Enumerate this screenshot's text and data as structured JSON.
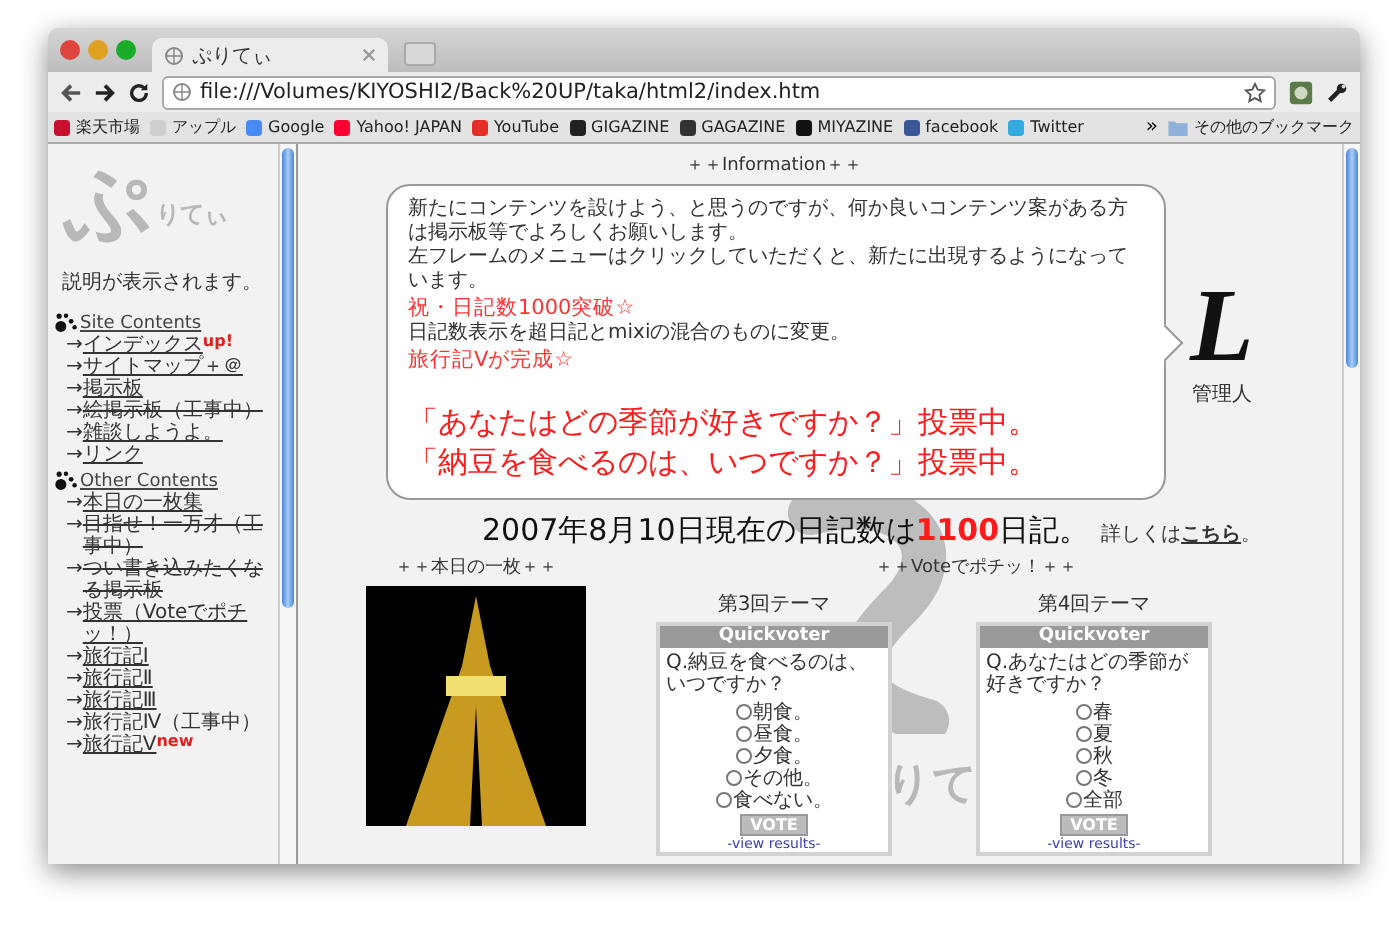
{
  "browser": {
    "tab": {
      "title": "ぷりてぃ",
      "selected": true
    },
    "url": "file:///Volumes/KIYOSHI2/Back%20UP/taka/html2/index.htm",
    "bookmarks": [
      {
        "label": "楽天市場",
        "color": "#c8102e"
      },
      {
        "label": "アップル",
        "color": "#cfcfcf"
      },
      {
        "label": "Google",
        "color": "#4a8af4"
      },
      {
        "label": "Yahoo! JAPAN",
        "color": "#ff0033"
      },
      {
        "label": "YouTube",
        "color": "#e52d27"
      },
      {
        "label": "GIGAZINE",
        "color": "#222222"
      },
      {
        "label": "GAGAZINE",
        "color": "#333333"
      },
      {
        "label": "MIYAZINE",
        "color": "#111111"
      },
      {
        "label": "facebook",
        "color": "#3b5998"
      },
      {
        "label": "Twitter",
        "color": "#33aadd"
      }
    ],
    "overflow": "»",
    "other_bookmarks": "その他のブックマーク"
  },
  "sidebar": {
    "logo_big": "ぷ",
    "logo_small": "りてぃ",
    "description": "説明が表示されます。",
    "sections": [
      {
        "title": "Site Contents",
        "items": [
          {
            "marker": "→",
            "label": "インデックス",
            "kind": "link",
            "badge": "up!"
          },
          {
            "marker": "→",
            "label": "サイトマップ＋＠",
            "kind": "link"
          },
          {
            "marker": "→",
            "label": "掲示板",
            "kind": "link"
          },
          {
            "marker": "→",
            "label": "絵掲示板（工事中）",
            "kind": "struck"
          },
          {
            "marker": "→",
            "label": "雑談しようよ。",
            "kind": "link"
          },
          {
            "marker": "→",
            "label": "リンク",
            "kind": "link"
          }
        ]
      },
      {
        "title": "Other Contents",
        "items": [
          {
            "marker": "→",
            "label": "本日の一枚集",
            "kind": "link"
          },
          {
            "marker": "→",
            "label": "目指せ！一万才（工事中）",
            "kind": "struck"
          },
          {
            "marker": "→",
            "label": "つい書き込みたくなる掲示板",
            "kind": "struck"
          },
          {
            "marker": "→",
            "label": "投票（Voteでポチッ！）",
            "kind": "link"
          },
          {
            "marker": "→",
            "label": "旅行記Ⅰ",
            "kind": "link"
          },
          {
            "marker": "→",
            "label": "旅行記Ⅱ",
            "kind": "link"
          },
          {
            "marker": "→",
            "label": "旅行記Ⅲ",
            "kind": "link"
          },
          {
            "marker": "→",
            "label": "旅行記Ⅳ（工事中）",
            "kind": "plain"
          },
          {
            "marker": "→",
            "label": "旅行記Ⅴ",
            "kind": "link",
            "badge": "new"
          }
        ]
      }
    ]
  },
  "main": {
    "info_title": "＋＋Information＋＋",
    "info_lines": [
      {
        "text": "新たにコンテンツを設けよう、と思うのですが、何か良いコンテンツ案がある方は掲示板等でよろしくお願いします。",
        "kind": "normal"
      },
      {
        "text": "左フレームのメニューはクリックしていただくと、新たに出現するようになっています。",
        "kind": "normal"
      },
      {
        "text": "祝・日記数1000突破☆",
        "kind": "highlight"
      },
      {
        "text": "日記数表示を超日記とmixiの混合のものに変更。",
        "kind": "normal"
      },
      {
        "text": "旅行記Ⅴが完成☆",
        "kind": "highlight"
      },
      {
        "text": "「あなたはどの季節が好きですか？」投票中。",
        "kind": "big"
      },
      {
        "text": "「納豆を食べるのは、いつですか？」投票中。",
        "kind": "big"
      }
    ],
    "admin": {
      "glyph": "L",
      "label": "管理人"
    },
    "diary": {
      "prefix": "2007年8月10日現在の日記数は",
      "count": "1100",
      "suffix": "日記。",
      "note": "詳しくは",
      "link": "こちら",
      "note_end": "。"
    },
    "background_logo": "りて",
    "photo_title": "＋＋本日の一枚＋＋",
    "vote_title": "＋＋Voteでポチッ！＋＋",
    "polls": [
      {
        "theme": "第3回テーマ",
        "header": "Quickvoter",
        "question": "Q.納豆を食べるのは、いつですか？",
        "options": [
          {
            "label": "朝食。",
            "selected": false
          },
          {
            "label": "昼食。",
            "selected": false
          },
          {
            "label": "夕食。",
            "selected": false
          },
          {
            "label": "その他。",
            "selected": false
          },
          {
            "label": "食べない。",
            "selected": false
          }
        ],
        "button": "VOTE",
        "results": "-view results-"
      },
      {
        "theme": "第4回テーマ",
        "header": "Quickvoter",
        "question": "Q.あなたはどの季節が好きですか？",
        "options": [
          {
            "label": "春",
            "selected": false
          },
          {
            "label": "夏",
            "selected": false
          },
          {
            "label": "秋",
            "selected": false
          },
          {
            "label": "冬",
            "selected": false
          },
          {
            "label": "全部",
            "selected": false
          }
        ],
        "button": "VOTE",
        "results": "-view results-"
      }
    ]
  }
}
